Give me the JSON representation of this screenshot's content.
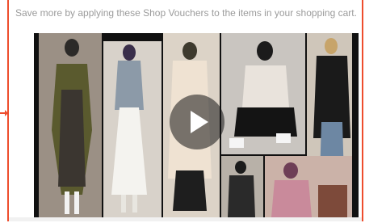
{
  "voucher_notice": {
    "text": "Save more by applying these Shop Vouchers to the items in your shopping cart."
  },
  "video": {
    "play_icon": "play-icon",
    "thumbnail_icon": "fashion-collage-thumbnail"
  },
  "colors": {
    "accent": "#ee4d2d",
    "notice_text": "#9b9b9b",
    "video_bg": "#111111"
  }
}
